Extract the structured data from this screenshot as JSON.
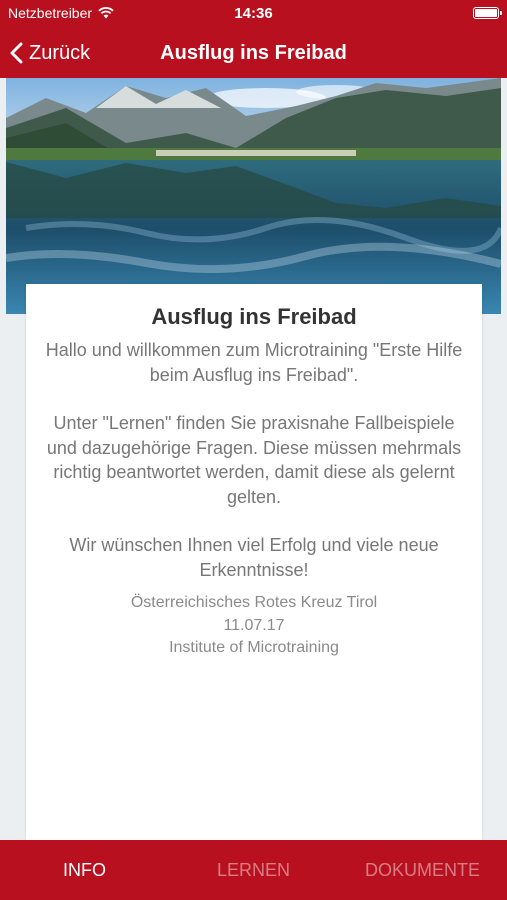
{
  "status": {
    "carrier": "Netzbetreiber",
    "time": "14:36"
  },
  "nav": {
    "back_label": "Zurück",
    "title": "Ausflug ins Freibad"
  },
  "card": {
    "title": "Ausflug ins Freibad",
    "paragraphs": [
      "Hallo und willkommen zum Microtraining \"Erste Hilfe beim Ausflug ins Freibad\".",
      "Unter \"Lernen\" finden Sie praxisnahe Fallbeispiele und dazugehörige Fragen. Diese müssen mehrmals richtig beantwortet werden, damit diese als gelernt gelten.",
      "Wir wünschen Ihnen viel Erfolg und viele neue Erkenntnisse!"
    ],
    "signature": {
      "organization": "Österreichisches Rotes Kreuz Tirol",
      "date": "11.07.17",
      "author": "Institute of Microtraining"
    }
  },
  "tabs": [
    {
      "label": "INFO",
      "active": true
    },
    {
      "label": "LERNEN",
      "active": false
    },
    {
      "label": "DOKUMENTE",
      "active": false
    }
  ],
  "colors": {
    "brand": "#b8101e",
    "background": "#eceff1",
    "card": "#ffffff"
  }
}
